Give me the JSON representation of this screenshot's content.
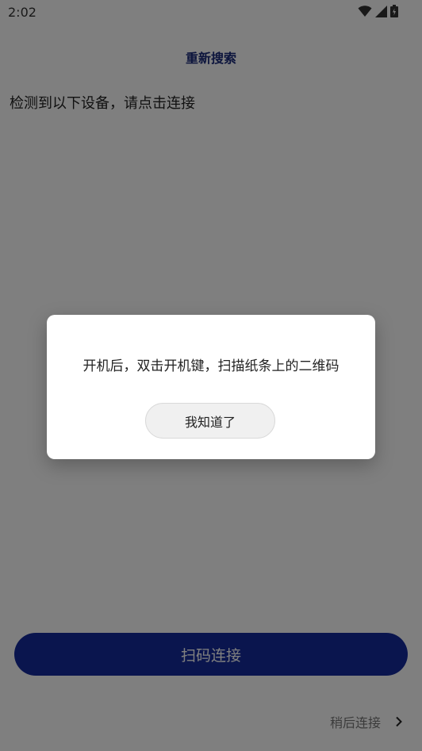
{
  "status_bar": {
    "time": "2:02",
    "icons": [
      "wifi-icon",
      "cell-signal-icon",
      "battery-icon"
    ]
  },
  "header": {
    "action_label": "重新搜索"
  },
  "main": {
    "detect_text": "检测到以下设备，请点击连接"
  },
  "primary_button": {
    "label": "扫码连接",
    "color": "#142a9c"
  },
  "secondary_link": {
    "label": "稍后连接",
    "icon": "chevron-right-icon"
  },
  "dialog": {
    "message": "开机后，双击开机键，扫描纸条上的二维码",
    "button_label": "我知道了"
  },
  "colors": {
    "accent": "#1a2a7a",
    "overlay": "rgba(0,0,0,0.5)"
  }
}
